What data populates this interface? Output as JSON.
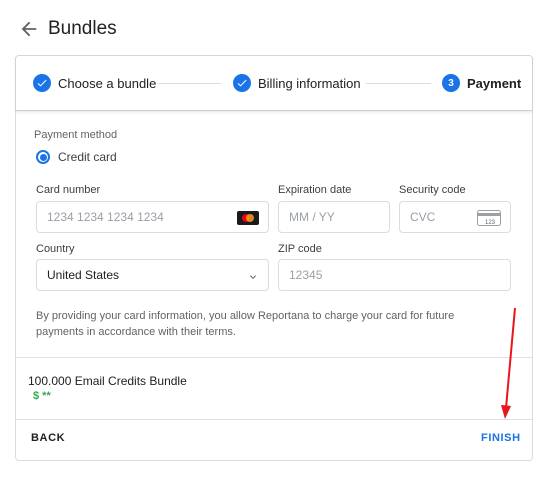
{
  "header": {
    "title": "Bundles"
  },
  "stepper": {
    "steps": [
      {
        "label": "Choose a bundle",
        "state": "completed",
        "icon": "check-circle-icon"
      },
      {
        "label": "Billing information",
        "state": "completed",
        "icon": "check-circle-icon"
      },
      {
        "label": "Payment",
        "state": "active",
        "number": "3"
      }
    ]
  },
  "payment": {
    "method_label": "Payment method",
    "method_option": "Credit card",
    "card_number": {
      "label": "Card number",
      "placeholder": "1234 1234 1234 1234",
      "icon": "mastercard-icon"
    },
    "expiration": {
      "label": "Expiration date",
      "placeholder": "MM / YY"
    },
    "security": {
      "label": "Security code",
      "placeholder": "CVC",
      "icon": "card-cvc-icon",
      "icon_text": "123"
    },
    "country": {
      "label": "Country",
      "value": "United States"
    },
    "zip": {
      "label": "ZIP code",
      "placeholder": "12345"
    },
    "disclaimer": "By providing your card information, you allow Reportana to charge your card for future payments in accordance with their terms."
  },
  "summary": {
    "bundle": "100.000 Email Credits Bundle",
    "price": "$ **"
  },
  "actions": {
    "back": "BACK",
    "finish": "FINISH"
  },
  "colors": {
    "accent": "#1a73e8",
    "price": "#34a853",
    "annotation": "#e8161b"
  }
}
